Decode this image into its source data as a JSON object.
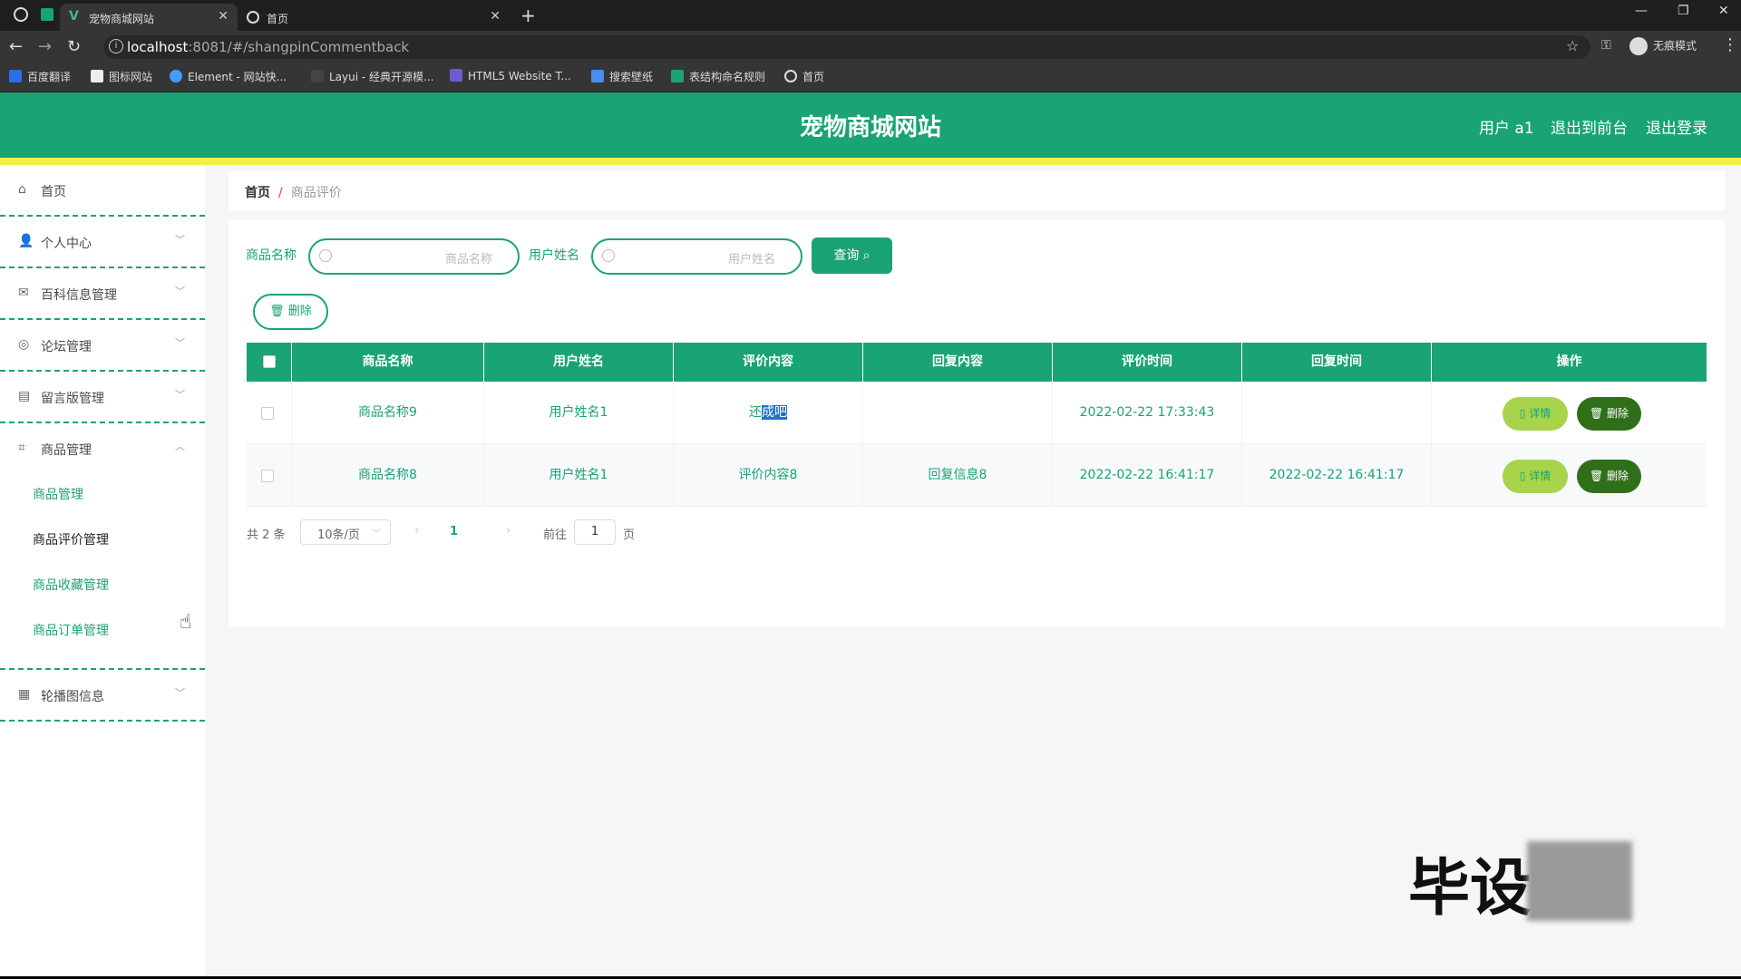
{
  "browser": {
    "tabs": [
      {
        "label": "宠物商城网站",
        "active": true
      },
      {
        "label": "首页",
        "active": false
      }
    ],
    "url_host": "localhost",
    "url_path": ":8081/#/shangpinCommentback",
    "incognito_label": "无痕模式",
    "bookmarks": [
      "百度翻译",
      "图标网站",
      "Element - 网站快...",
      "Layui - 经典开源模...",
      "HTML5 Website T...",
      "搜索壁纸",
      "表结构命名规则",
      "首页"
    ]
  },
  "header": {
    "title": "宠物商城网站",
    "user_label": "用户 a1",
    "back_front_label": "退出到前台",
    "logout_label": "退出登录"
  },
  "sidebar": {
    "items": [
      {
        "label": "首页",
        "icon": "home-icon"
      },
      {
        "label": "个人中心",
        "icon": "user-icon"
      },
      {
        "label": "百科信息管理",
        "icon": "mail-icon"
      },
      {
        "label": "论坛管理",
        "icon": "forum-icon"
      },
      {
        "label": "留言版管理",
        "icon": "briefcase-icon"
      },
      {
        "label": "商品管理",
        "icon": "crop-icon"
      },
      {
        "label": "轮播图信息",
        "icon": "grid-icon"
      }
    ],
    "submenu": [
      "商品管理",
      "商品评价管理",
      "商品收藏管理",
      "商品订单管理"
    ]
  },
  "breadcrumb": {
    "home": "首页",
    "separator": "/",
    "current": "商品评价"
  },
  "filters": {
    "product_label": "商品名称",
    "product_placeholder": "商品名称",
    "user_label": "用户姓名",
    "user_placeholder": "用户姓名",
    "query_label": "查询",
    "delete_label": "删除"
  },
  "table": {
    "columns": [
      "商品名称",
      "用户姓名",
      "评价内容",
      "回复内容",
      "评价时间",
      "回复时间",
      "操作"
    ],
    "rows": [
      {
        "product": "商品名称9",
        "user": "用户姓名1",
        "comment_pre": "还",
        "comment_hl": "成吧",
        "reply": "",
        "comment_time": "2022-02-22 17:33:43",
        "reply_time": ""
      },
      {
        "product": "商品名称8",
        "user": "用户姓名1",
        "comment_pre": "评价内容8",
        "comment_hl": "",
        "reply": "回复信息8",
        "comment_time": "2022-02-22 16:41:17",
        "reply_time": "2022-02-22 16:41:17"
      }
    ],
    "detail_label": "详情",
    "delete_label": "删除"
  },
  "pager": {
    "total": "共 2 条",
    "page_size": "10条/页",
    "current_page": "1",
    "goto_label": "前往",
    "goto_value": "1",
    "page_suffix": "页"
  },
  "watermark": "毕设",
  "colors": {
    "primary": "#1aa374",
    "accent_yellow": "#f1f04a",
    "detail_btn": "#a7d44a",
    "delete_btn": "#2f6f1a"
  }
}
